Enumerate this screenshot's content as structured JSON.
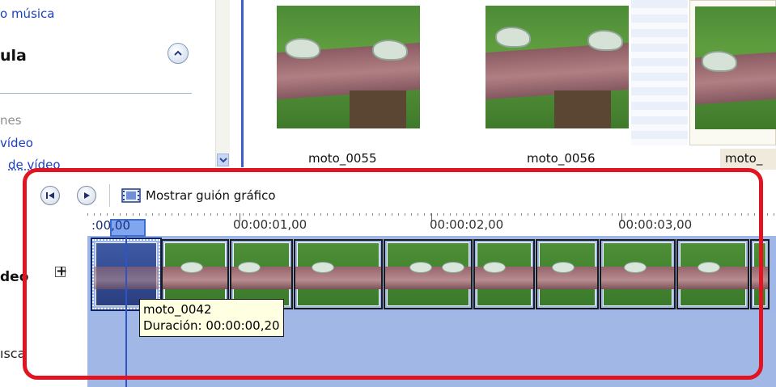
{
  "task_pane": {
    "link_music": "o música",
    "title": "ula",
    "gray_text": "nes",
    "link_video": "vídeo",
    "link_video_effects": "de vídeo"
  },
  "collection": {
    "thumbnails": [
      {
        "label": "moto_0055"
      },
      {
        "label": "moto_0056"
      },
      {
        "label": "moto_"
      }
    ]
  },
  "toolbar": {
    "storyboard_label": "Mostrar guión gráfico"
  },
  "ruler": {
    "playhead_time": ":00,00",
    "ticks": [
      "00:00:01,00",
      "00:00:02,00",
      "00:00:03,00"
    ]
  },
  "tracks": {
    "video_label": "deo",
    "expand_symbol": "+",
    "music_label": "ısca"
  },
  "tooltip": {
    "clip_name": "moto_0042",
    "duration": "Duración: 00:00:00,20"
  },
  "icons": {
    "rewind": "rewind-icon",
    "play": "play-icon",
    "storyboard": "filmstrip-icon",
    "collapse": "chevron-up-icon",
    "scroll_down": "chevron-down-icon"
  },
  "colors": {
    "highlight": "#e01521",
    "link": "#1b3fc1",
    "track": "#9fb7e8",
    "tooltip_bg": "#ffffe1"
  }
}
